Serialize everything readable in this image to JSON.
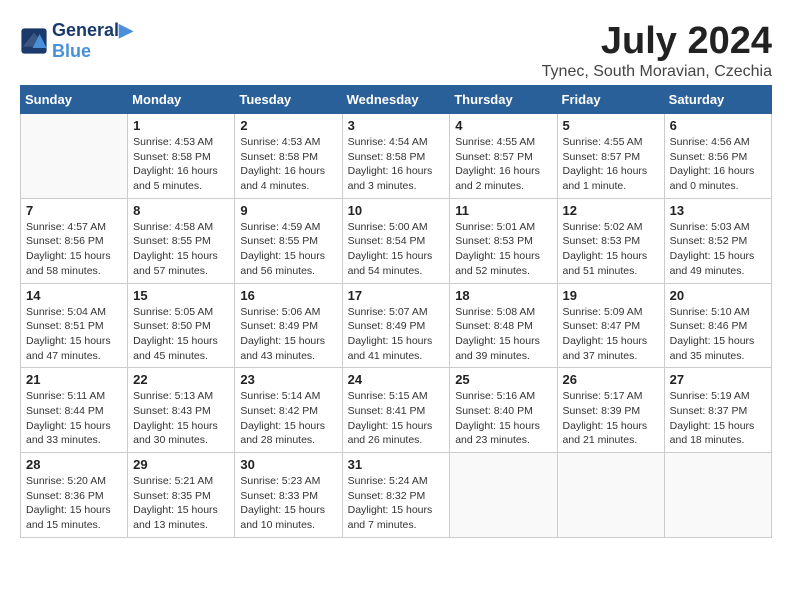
{
  "header": {
    "logo_line1": "General",
    "logo_line2": "Blue",
    "month_title": "July 2024",
    "subtitle": "Tynec, South Moravian, Czechia"
  },
  "weekdays": [
    "Sunday",
    "Monday",
    "Tuesday",
    "Wednesday",
    "Thursday",
    "Friday",
    "Saturday"
  ],
  "weeks": [
    [
      {
        "day": "",
        "info": ""
      },
      {
        "day": "1",
        "info": "Sunrise: 4:53 AM\nSunset: 8:58 PM\nDaylight: 16 hours\nand 5 minutes."
      },
      {
        "day": "2",
        "info": "Sunrise: 4:53 AM\nSunset: 8:58 PM\nDaylight: 16 hours\nand 4 minutes."
      },
      {
        "day": "3",
        "info": "Sunrise: 4:54 AM\nSunset: 8:58 PM\nDaylight: 16 hours\nand 3 minutes."
      },
      {
        "day": "4",
        "info": "Sunrise: 4:55 AM\nSunset: 8:57 PM\nDaylight: 16 hours\nand 2 minutes."
      },
      {
        "day": "5",
        "info": "Sunrise: 4:55 AM\nSunset: 8:57 PM\nDaylight: 16 hours\nand 1 minute."
      },
      {
        "day": "6",
        "info": "Sunrise: 4:56 AM\nSunset: 8:56 PM\nDaylight: 16 hours\nand 0 minutes."
      }
    ],
    [
      {
        "day": "7",
        "info": "Sunrise: 4:57 AM\nSunset: 8:56 PM\nDaylight: 15 hours\nand 58 minutes."
      },
      {
        "day": "8",
        "info": "Sunrise: 4:58 AM\nSunset: 8:55 PM\nDaylight: 15 hours\nand 57 minutes."
      },
      {
        "day": "9",
        "info": "Sunrise: 4:59 AM\nSunset: 8:55 PM\nDaylight: 15 hours\nand 56 minutes."
      },
      {
        "day": "10",
        "info": "Sunrise: 5:00 AM\nSunset: 8:54 PM\nDaylight: 15 hours\nand 54 minutes."
      },
      {
        "day": "11",
        "info": "Sunrise: 5:01 AM\nSunset: 8:53 PM\nDaylight: 15 hours\nand 52 minutes."
      },
      {
        "day": "12",
        "info": "Sunrise: 5:02 AM\nSunset: 8:53 PM\nDaylight: 15 hours\nand 51 minutes."
      },
      {
        "day": "13",
        "info": "Sunrise: 5:03 AM\nSunset: 8:52 PM\nDaylight: 15 hours\nand 49 minutes."
      }
    ],
    [
      {
        "day": "14",
        "info": "Sunrise: 5:04 AM\nSunset: 8:51 PM\nDaylight: 15 hours\nand 47 minutes."
      },
      {
        "day": "15",
        "info": "Sunrise: 5:05 AM\nSunset: 8:50 PM\nDaylight: 15 hours\nand 45 minutes."
      },
      {
        "day": "16",
        "info": "Sunrise: 5:06 AM\nSunset: 8:49 PM\nDaylight: 15 hours\nand 43 minutes."
      },
      {
        "day": "17",
        "info": "Sunrise: 5:07 AM\nSunset: 8:49 PM\nDaylight: 15 hours\nand 41 minutes."
      },
      {
        "day": "18",
        "info": "Sunrise: 5:08 AM\nSunset: 8:48 PM\nDaylight: 15 hours\nand 39 minutes."
      },
      {
        "day": "19",
        "info": "Sunrise: 5:09 AM\nSunset: 8:47 PM\nDaylight: 15 hours\nand 37 minutes."
      },
      {
        "day": "20",
        "info": "Sunrise: 5:10 AM\nSunset: 8:46 PM\nDaylight: 15 hours\nand 35 minutes."
      }
    ],
    [
      {
        "day": "21",
        "info": "Sunrise: 5:11 AM\nSunset: 8:44 PM\nDaylight: 15 hours\nand 33 minutes."
      },
      {
        "day": "22",
        "info": "Sunrise: 5:13 AM\nSunset: 8:43 PM\nDaylight: 15 hours\nand 30 minutes."
      },
      {
        "day": "23",
        "info": "Sunrise: 5:14 AM\nSunset: 8:42 PM\nDaylight: 15 hours\nand 28 minutes."
      },
      {
        "day": "24",
        "info": "Sunrise: 5:15 AM\nSunset: 8:41 PM\nDaylight: 15 hours\nand 26 minutes."
      },
      {
        "day": "25",
        "info": "Sunrise: 5:16 AM\nSunset: 8:40 PM\nDaylight: 15 hours\nand 23 minutes."
      },
      {
        "day": "26",
        "info": "Sunrise: 5:17 AM\nSunset: 8:39 PM\nDaylight: 15 hours\nand 21 minutes."
      },
      {
        "day": "27",
        "info": "Sunrise: 5:19 AM\nSunset: 8:37 PM\nDaylight: 15 hours\nand 18 minutes."
      }
    ],
    [
      {
        "day": "28",
        "info": "Sunrise: 5:20 AM\nSunset: 8:36 PM\nDaylight: 15 hours\nand 15 minutes."
      },
      {
        "day": "29",
        "info": "Sunrise: 5:21 AM\nSunset: 8:35 PM\nDaylight: 15 hours\nand 13 minutes."
      },
      {
        "day": "30",
        "info": "Sunrise: 5:23 AM\nSunset: 8:33 PM\nDaylight: 15 hours\nand 10 minutes."
      },
      {
        "day": "31",
        "info": "Sunrise: 5:24 AM\nSunset: 8:32 PM\nDaylight: 15 hours\nand 7 minutes."
      },
      {
        "day": "",
        "info": ""
      },
      {
        "day": "",
        "info": ""
      },
      {
        "day": "",
        "info": ""
      }
    ]
  ]
}
